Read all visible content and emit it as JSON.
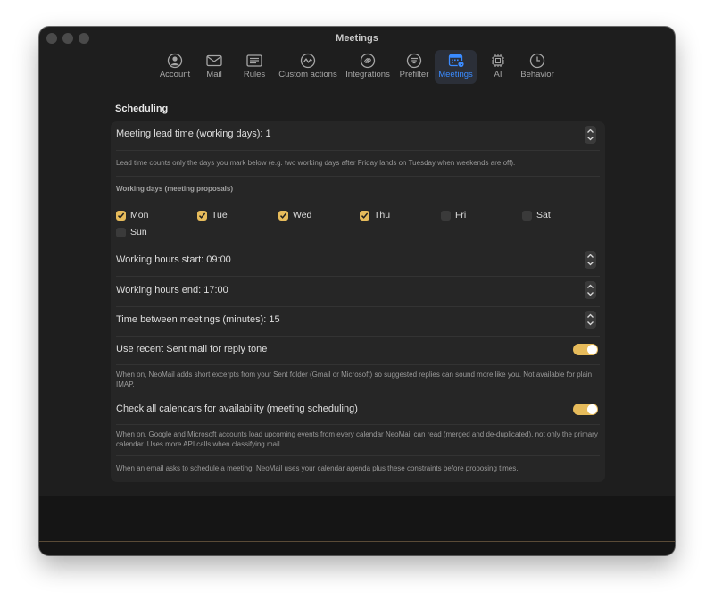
{
  "window": {
    "title": "Meetings"
  },
  "tabs": [
    {
      "id": "account",
      "label": "Account",
      "icon": "person-circle-icon",
      "active": false
    },
    {
      "id": "mail",
      "label": "Mail",
      "icon": "envelope-icon",
      "active": false
    },
    {
      "id": "rules",
      "label": "Rules",
      "icon": "list-rules-icon",
      "active": false
    },
    {
      "id": "custom-actions",
      "label": "Custom actions",
      "icon": "wave-circle-icon",
      "active": false
    },
    {
      "id": "integrations",
      "label": "Integrations",
      "icon": "link-circle-icon",
      "active": false
    },
    {
      "id": "prefilter",
      "label": "Prefilter",
      "icon": "filter-circle-icon",
      "active": false
    },
    {
      "id": "meetings",
      "label": "Meetings",
      "icon": "calendar-badge-icon",
      "active": true
    },
    {
      "id": "ai",
      "label": "AI",
      "icon": "cpu-chip-icon",
      "active": false
    },
    {
      "id": "behavior",
      "label": "Behavior",
      "icon": "clock-icon",
      "active": false
    }
  ],
  "scheduling": {
    "title": "Scheduling",
    "lead_time_label": "Meeting lead time (working days): 1",
    "lead_time_note": "Lead time counts only the days you mark below (e.g. two working days after Friday lands on Tuesday when weekends are off).",
    "working_days_heading": "Working days (meeting proposals)",
    "days": [
      {
        "label": "Mon",
        "checked": true
      },
      {
        "label": "Tue",
        "checked": true
      },
      {
        "label": "Wed",
        "checked": true
      },
      {
        "label": "Thu",
        "checked": true
      },
      {
        "label": "Fri",
        "checked": false
      },
      {
        "label": "Sat",
        "checked": false
      },
      {
        "label": "Sun",
        "checked": false
      }
    ],
    "hours_start_label": "Working hours start: 09:00",
    "hours_end_label": "Working hours end: 17:00",
    "between_label": "Time between meetings (minutes): 15",
    "sent_tone_label": "Use recent Sent mail for reply tone",
    "sent_tone_on": true,
    "sent_tone_note": "When on, NeoMail adds short excerpts from your Sent folder (Gmail or Microsoft) so suggested replies can sound more like you. Not available for plain IMAP.",
    "all_calendars_label": "Check all calendars for availability (meeting scheduling)",
    "all_calendars_on": true,
    "all_calendars_note": "When on, Google and Microsoft accounts load upcoming events from every calendar NeoMail can read (merged and de-duplicated), not only the primary calendar. Uses more API calls when classifying mail.",
    "footer_note": "When an email asks to schedule a meeting, NeoMail uses your calendar agenda plus these constraints before proposing times."
  },
  "colors": {
    "accent": "#e6bb5b",
    "active_tab": "#3a8bff",
    "background": "#1e1e1e"
  }
}
